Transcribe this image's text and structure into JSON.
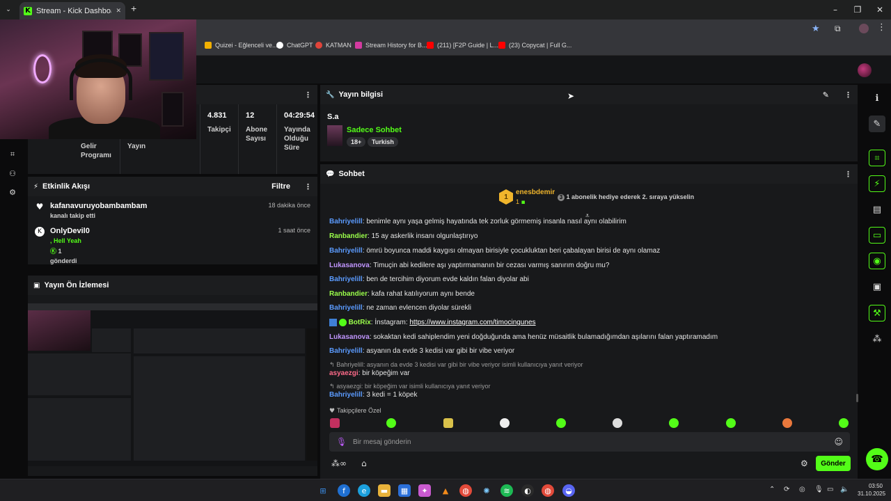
{
  "browser": {
    "tab_title": "Stream - Kick Dashboard",
    "tab_close": "✕",
    "new_tab": "+",
    "bookmarks": [
      {
        "label": "Quizei - Eğlenceli ve...",
        "color": "#f2b000"
      },
      {
        "label": "ChatGPT",
        "color": "#ffffff"
      },
      {
        "label": "KATMAN",
        "color": "#e0443a"
      },
      {
        "label": "Stream History for B...",
        "color": "#d33aa0"
      },
      {
        "label": "(211) [F2P Guide | L...",
        "color": "#ff0000"
      },
      {
        "label": "(23) Copycat | Full G...",
        "color": "#ff0000"
      }
    ]
  },
  "stats": [
    {
      "value": "",
      "label": "Gelir Programı"
    },
    {
      "value": "",
      "label": "Yayın"
    },
    {
      "value": "4.831",
      "label": "Takipçi"
    },
    {
      "value": "12",
      "label": "Abone Sayısı"
    },
    {
      "value": "04:29:54",
      "label": "Yayında Olduğu Süre"
    }
  ],
  "stream_info": {
    "header": "Yayın bilgisi",
    "title": "S.a",
    "category": "Sadece Sohbet",
    "tags": [
      "18+",
      "Turkish"
    ]
  },
  "activity": {
    "header": "Etkinlik Akışı",
    "filter_label": "Filtre",
    "items": [
      {
        "name": "kafanavuruyobambambam",
        "sub": "kanalı takip etti",
        "time": "18 dakika önce"
      },
      {
        "name": "OnlyDevil0",
        "message": ", Hell Yeah",
        "amount": "1",
        "sub": "gönderdi",
        "time": "1 saat önce"
      }
    ]
  },
  "preview": {
    "header": "Yayın Ön İzlemesi"
  },
  "chat": {
    "header": "Sohbet",
    "pinned_user": "enesbdemir",
    "pinned_count": "1",
    "pinned_rank": "1",
    "pinned_msg_num": "3",
    "pinned_msg": "1 abonelik hediye ederek 2. sıraya yükselin",
    "messages": [
      {
        "user": "Bahriyelill",
        "color": "blue",
        "text": ": benimle aynı yaşa gelmiş hayatında tek zorluk görmemiş insanla nasıl aynı olabilirim"
      },
      {
        "user": "Ranbandier",
        "color": "green",
        "text": ": 15 ay askerlik insanı olgunlaştırıyo"
      },
      {
        "user": "Bahriyelill",
        "color": "blue",
        "text": ": ömrü boyunca maddi kaygısı olmayan birisiyle çocukluktan beri çabalayan birisi de aynı olamaz"
      },
      {
        "user": "Lukasanova",
        "color": "purple",
        "text": ": Timuçin abi kedilere aşı yaptırmamanın bir cezası varmış sanırım doğru mu?"
      },
      {
        "user": "Bahriyelill",
        "color": "blue",
        "text": ": ben de tercihim diyorum evde kaldın falan diyolar abi"
      },
      {
        "user": "Ranbandier",
        "color": "green",
        "text": ": kafa rahat katılıyorum aynı bende"
      },
      {
        "user": "Bahriyelill",
        "color": "blue",
        "text": ": ne zaman evlencen diyolar sürekli"
      },
      {
        "user": "BotRix",
        "color": "green",
        "text": ": İnstagram: ",
        "link": "https://www.instagram.com/timocingunes"
      },
      {
        "user": "Lukasanova",
        "color": "purple",
        "text": ": sokaktan kedi sahiplendim yeni doğduğunda ama henüz müsaitlik bulamadığımdan aşılarını falan yaptıramadım"
      },
      {
        "user": "Bahriyelill",
        "color": "blue",
        "text": ": asyanın da evde 3 kedisi var gibi bir vibe veriyor"
      },
      {
        "user": "asyaezgi",
        "color": "red",
        "text": ": bir köpeğim var",
        "reply": "Bahriyelill: asyanın da evde 3 kedisi var gibi bir vibe veriyor isimli kullanıcıya yanıt veriyor"
      },
      {
        "user": "Bahriyelill",
        "color": "blue",
        "text": ": 3 kedi = 1 köpek",
        "reply": "asyaezgi: bir köpeğim var isimli kullanıcıya yanıt veriyor"
      }
    ],
    "followers_only": "Takipçilere Özel",
    "input_placeholder": "Bir mesaj gönderin",
    "send_label": "Gönder"
  },
  "taskbar": {
    "time": "03:50",
    "date": "31.10.2025"
  },
  "colors": {
    "accent": "#53fc18",
    "panel": "#18191b",
    "bg": "#0b0b0c"
  }
}
